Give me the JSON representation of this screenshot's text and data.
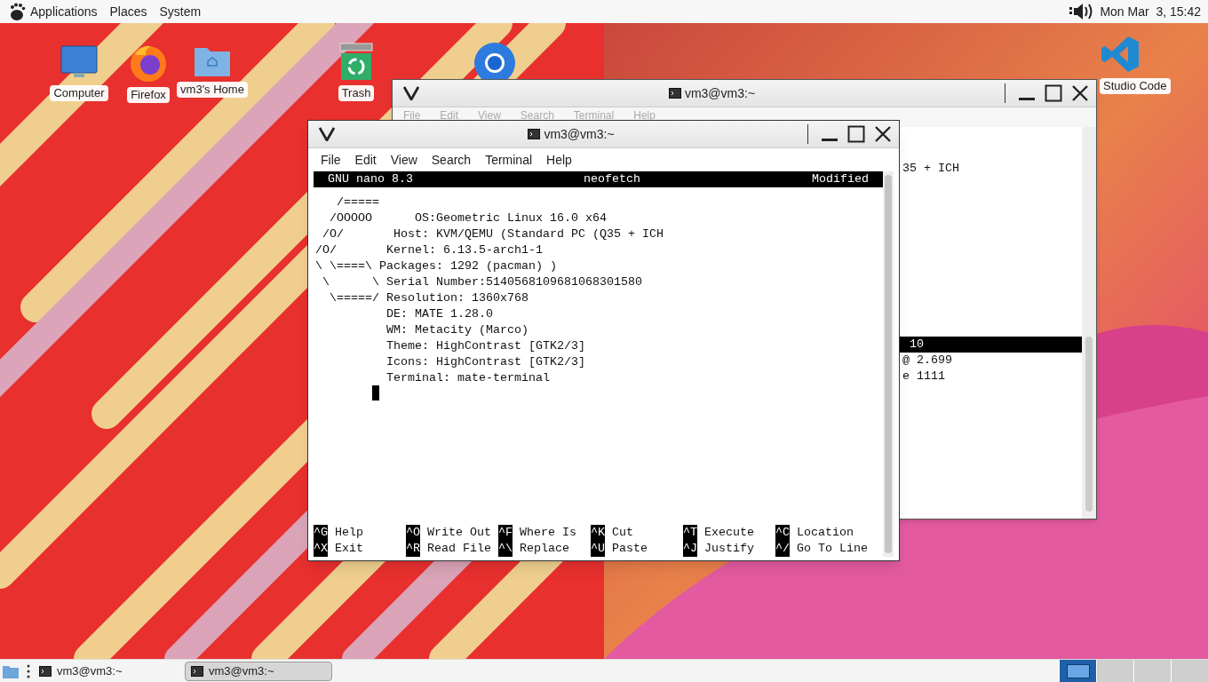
{
  "top_panel": {
    "menus": [
      "Applications",
      "Places",
      "System"
    ],
    "clock": "Mon Mar  3, 15:42"
  },
  "desktop_icons": [
    {
      "kind": "computer",
      "label": "Computer"
    },
    {
      "kind": "firefox",
      "label": "Firefox"
    },
    {
      "kind": "home",
      "label": "vm3's Home"
    },
    {
      "kind": "trash",
      "label": "Trash"
    },
    {
      "kind": "chrome"
    },
    {
      "kind": "vscode",
      "label": "Studio Code"
    }
  ],
  "back_window": {
    "title": "vm3@vm3:~",
    "menus": [
      "File",
      "Edit",
      "View",
      "Search",
      "Terminal",
      "Help"
    ],
    "lines": [
      {
        "text": "35 + ICH",
        "highlighted": false
      },
      {
        "text": " 10",
        "highlighted": true
      },
      {
        "text": "@ 2.699",
        "highlighted": false
      },
      {
        "text": "e 1111",
        "highlighted": false
      }
    ]
  },
  "front_window": {
    "title": "vm3@vm3:~",
    "menus": [
      "File",
      "Edit",
      "View",
      "Search",
      "Terminal",
      "Help"
    ],
    "nano": {
      "version": "GNU nano 8.3",
      "filename": "neofetch",
      "status": "Modified",
      "lines": [
        "   /=====",
        "  /OOOOO      OS:Geometric Linux 16.0 x64",
        " /O/       Host: KVM/QEMU (Standard PC (Q35 + ICH",
        "/O/       Kernel: 6.13.5-arch1-1",
        "\\ \\====\\ Packages: 1292 (pacman) )",
        " \\      \\ Serial Number:5140568109681068301580",
        "  \\=====/ Resolution: 1360x768",
        "          DE: MATE 1.28.0",
        "          WM: Metacity (Marco)",
        "          Theme: HighContrast [GTK2/3]",
        "          Icons: HighContrast [GTK2/3]",
        "          Terminal: mate-terminal"
      ],
      "shortcuts": [
        [
          {
            "key": "^G",
            "label": "Help"
          },
          {
            "key": "^O",
            "label": "Write Out"
          },
          {
            "key": "^F",
            "label": "Where Is"
          },
          {
            "key": "^K",
            "label": "Cut"
          },
          {
            "key": "^T",
            "label": "Execute"
          },
          {
            "key": "^C",
            "label": "Location"
          }
        ],
        [
          {
            "key": "^X",
            "label": "Exit"
          },
          {
            "key": "^R",
            "label": "Read File"
          },
          {
            "key": "^\\",
            "label": "Replace"
          },
          {
            "key": "^U",
            "label": "Paste"
          },
          {
            "key": "^J",
            "label": "Justify"
          },
          {
            "key": "^/",
            "label": "Go To Line"
          }
        ]
      ]
    }
  },
  "taskbar": {
    "tasks": [
      {
        "label": "vm3@vm3:~",
        "selected": false
      },
      {
        "label": "vm3@vm3:~",
        "selected": true
      }
    ],
    "workspaces": [
      {
        "selected": true
      },
      {
        "selected": false
      },
      {
        "selected": false
      },
      {
        "selected": false
      }
    ]
  }
}
